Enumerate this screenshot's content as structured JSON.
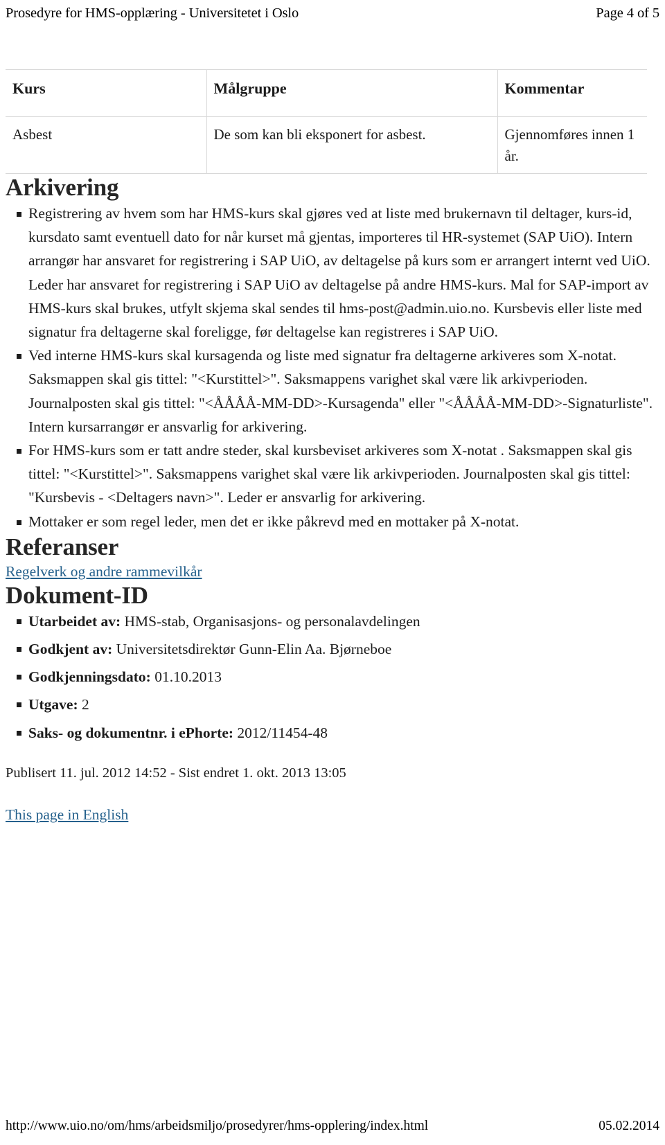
{
  "print_header": {
    "title": "Prosedyre for HMS-opplæring - Universitetet i Oslo",
    "page_label": "Page 4 of 5"
  },
  "table": {
    "columns": [
      "Kurs",
      "Målgruppe",
      "Kommentar"
    ],
    "rows": [
      {
        "kurs": "Asbest",
        "malgruppe": "De som kan bli eksponert for asbest.",
        "kommentar": "Gjennomføres innen 1 år."
      }
    ]
  },
  "arkivering": {
    "heading": "Arkivering",
    "bullets": [
      "Registrering av hvem som har HMS-kurs skal gjøres ved at liste med brukernavn til deltager, kurs-id, kursdato samt eventuell dato for når kurset må gjentas, importeres til HR-systemet (SAP UiO). Intern arrangør har ansvaret for registrering i SAP UiO, av deltagelse på kurs som er arrangert internt ved UiO. Leder har ansvaret for registrering i SAP UiO av deltagelse på andre HMS-kurs. Mal for SAP-import av HMS-kurs skal brukes, utfylt skjema skal sendes til hms-post@admin.uio.no. Kursbevis eller liste med signatur fra deltagerne skal foreligge, før deltagelse kan registreres i SAP UiO.",
      "Ved interne HMS-kurs skal kursagenda og liste med signatur fra deltagerne arkiveres som X-notat. Saksmappen skal gis tittel: \"<Kurstittel>\". Saksmappens varighet skal være lik arkivperioden. Journalposten skal gis tittel: \"<ÅÅÅÅ-MM-DD>-Kursagenda\" eller \"<ÅÅÅÅ-MM-DD>-Signaturliste\". Intern kursarrangør er ansvarlig for arkivering.",
      "For HMS-kurs som er tatt andre steder, skal kursbeviset arkiveres som X-notat . Saksmappen skal gis tittel: \"<Kurstittel>\". Saksmappens varighet skal være lik arkivperioden. Journalposten skal gis tittel: \"Kursbevis - <Deltagers navn>\".  Leder er ansvarlig for arkivering.",
      "Mottaker er som regel leder, men det er ikke påkrevd med en mottaker på X-notat."
    ]
  },
  "referanser": {
    "heading": "Referanser",
    "link_label": "Regelverk og andre rammevilkår"
  },
  "dokument_id": {
    "heading": "Dokument-ID",
    "items": [
      {
        "label": "Utarbeidet av:",
        "value": "HMS-stab, Organisasjons- og personalavdelingen"
      },
      {
        "label": "Godkjent av:",
        "value": "Universitetsdirektør Gunn-Elin Aa. Bjørneboe"
      },
      {
        "label": "Godkjenningsdato:",
        "value": "01.10.2013"
      },
      {
        "label": "Utgave:",
        "value": "2"
      },
      {
        "label": "Saks- og dokumentnr. i ePhorte:",
        "value": "2012/11454-48"
      }
    ],
    "published_line": "Publisert 11. jul. 2012 14:52 - Sist endret 1. okt. 2013 13:05",
    "english_link_label": "This page in English"
  },
  "print_footer": {
    "url": "http://www.uio.no/om/hms/arbeidsmiljo/prosedyrer/hms-opplering/index.html",
    "date": "05.02.2014"
  },
  "colors": {
    "link": "#24608c",
    "text": "#1c1c1c",
    "table_border": "#d8d8d8"
  }
}
